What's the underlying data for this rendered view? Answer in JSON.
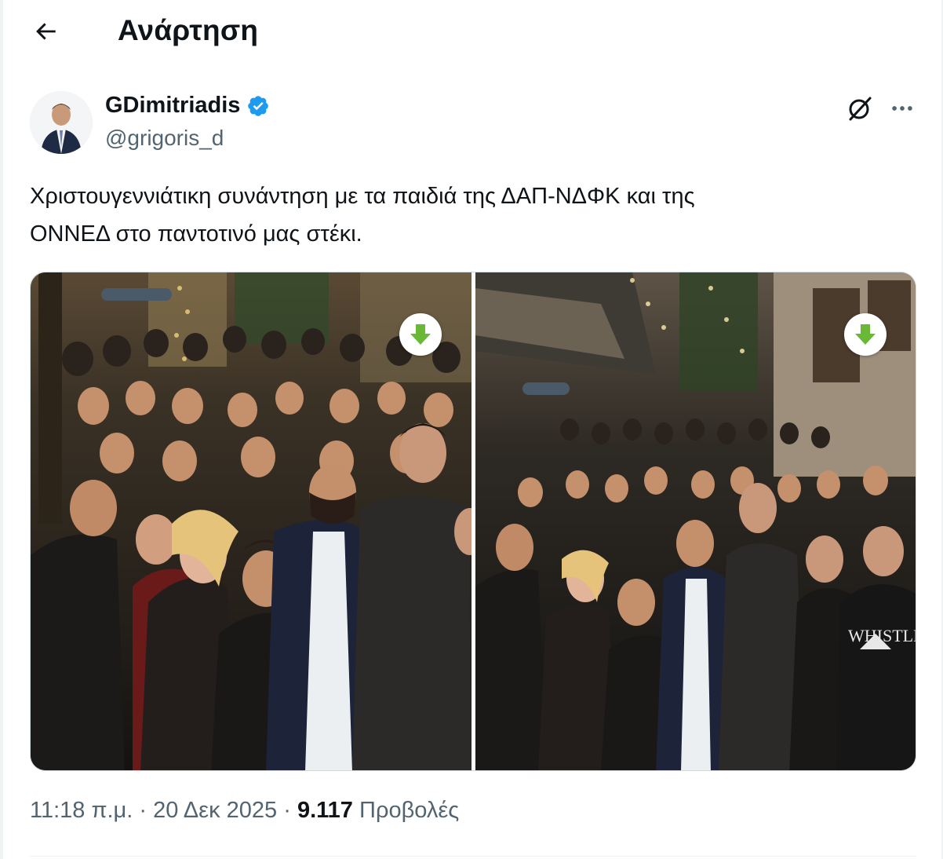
{
  "header": {
    "title": "Ανάρτηση",
    "back_icon": "arrow-left-icon"
  },
  "author": {
    "display_name": "GDimitriadis",
    "handle": "@grigoris_d",
    "verified_icon": "verified-badge-icon",
    "verified_color": "#1d9bf0"
  },
  "actions": {
    "grok_icon": "grok-icon",
    "more_icon": "more-horizontal-icon"
  },
  "tweet": {
    "text": "Χριστουγεννιάτικη συνάντηση με τα παιδιά της ΔΑΠ-ΝΔΦΚ και της\nΟΝΝΕΔ στο παντοτινό μας στέκι."
  },
  "media": {
    "photos": [
      {
        "alt": "Group photo of a crowd at a night street gathering",
        "badge_icon": "download-arrow-icon"
      },
      {
        "alt": "Wider group photo of the crowd on a lit street",
        "badge_icon": "download-arrow-icon"
      }
    ],
    "badge_color": "#6ab936",
    "sweatshirt_text": "WHISTLER"
  },
  "meta": {
    "time": "11:18 π.μ.",
    "separator": " · ",
    "date": "20 Δεκ 2025",
    "views_count": "9.117",
    "views_label": "Προβολές"
  }
}
